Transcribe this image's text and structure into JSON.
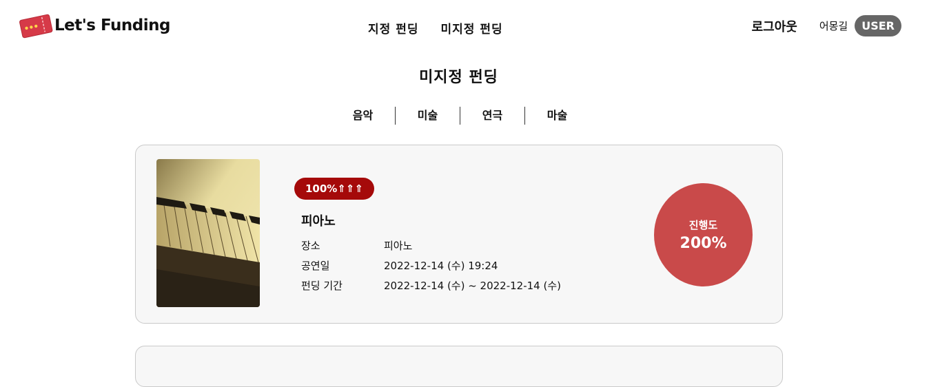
{
  "header": {
    "logo_text": "Let's Funding",
    "nav": [
      "지정 펀딩",
      "미지정 펀딩"
    ],
    "logout_label": "로그아웃",
    "username": "어몽길",
    "role_badge": "USER"
  },
  "page": {
    "title": "미지정 펀딩",
    "tabs": [
      "음악",
      "미술",
      "연극",
      "마술"
    ]
  },
  "funding_card": {
    "badge": "100%⇑⇑⇑",
    "name": "피아노",
    "location_label": "장소",
    "location": "피아노",
    "date_label": "공연일",
    "date": "2022-12-14 (수) 19:24",
    "period_label": "펀딩 기간",
    "period": "2022-12-14 (수) ~ 2022-12-14 (수)",
    "progress_label": "진행도",
    "progress_value": "200%"
  },
  "colors": {
    "badge": "#a50a0a",
    "progress_circle": "#c94a4a",
    "user_badge": "#666666"
  }
}
